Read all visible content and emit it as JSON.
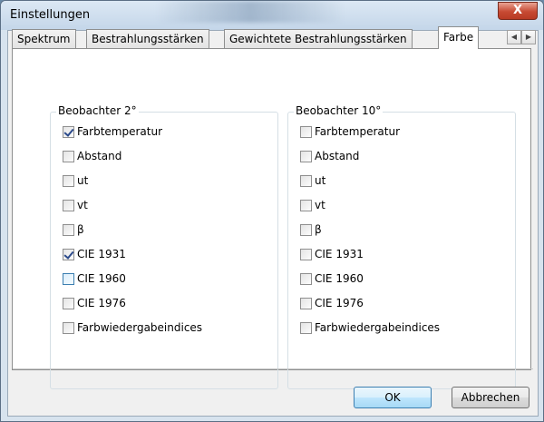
{
  "window": {
    "title": "Einstellungen",
    "close_symbol": "X"
  },
  "tabs": [
    {
      "label": "Spektrum"
    },
    {
      "label": "Bestrahlungsstärken"
    },
    {
      "label": "Gewichtete Bestrahlungsstärken"
    },
    {
      "label": "Farbe",
      "active": true
    }
  ],
  "tab_scroll": {
    "left": "◀",
    "right": "▶"
  },
  "groups": [
    {
      "title": "Beobachter 2°",
      "items": [
        {
          "label": "Farbtemperatur",
          "checked": true
        },
        {
          "label": "Abstand",
          "checked": false
        },
        {
          "label": "ut",
          "checked": false
        },
        {
          "label": "vt",
          "checked": false
        },
        {
          "label": "β",
          "checked": false
        },
        {
          "label": "CIE 1931",
          "checked": true
        },
        {
          "label": "CIE 1960",
          "checked": false,
          "focused": true
        },
        {
          "label": "CIE 1976",
          "checked": false
        },
        {
          "label": "Farbwiedergabeindices",
          "checked": false
        }
      ]
    },
    {
      "title": "Beobachter 10°",
      "items": [
        {
          "label": "Farbtemperatur",
          "checked": false
        },
        {
          "label": "Abstand",
          "checked": false
        },
        {
          "label": "ut",
          "checked": false
        },
        {
          "label": "vt",
          "checked": false
        },
        {
          "label": "β",
          "checked": false
        },
        {
          "label": "CIE 1931",
          "checked": false
        },
        {
          "label": "CIE 1960",
          "checked": false
        },
        {
          "label": "CIE 1976",
          "checked": false
        },
        {
          "label": "Farbwiedergabeindices",
          "checked": false
        }
      ]
    }
  ],
  "buttons": {
    "ok": "OK",
    "cancel": "Abbrechen"
  }
}
